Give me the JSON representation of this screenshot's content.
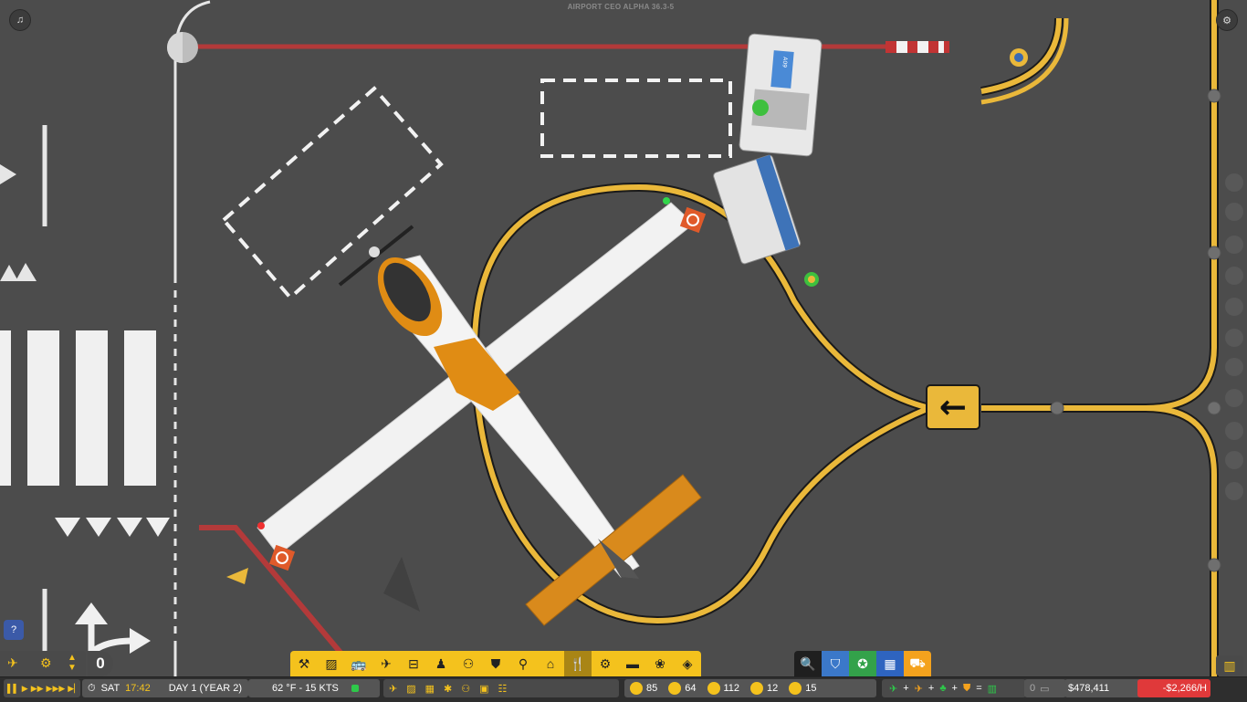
{
  "window": {
    "title": "AIRPORT CEO ALPHA 36.3-5"
  },
  "top_left_button": {
    "icon": "alert-icon",
    "glyph": "♫"
  },
  "top_right_button": {
    "icon": "settings-icon",
    "glyph": "⚙"
  },
  "scene": {
    "aircraft_stand_sign": "←",
    "service_vehicle_label": "A09"
  },
  "help_button": {
    "label": "?"
  },
  "left_panel": {
    "counter": "0"
  },
  "toolbar": {
    "items": [
      {
        "name": "build-icon",
        "glyph": "⚒"
      },
      {
        "name": "zone-icon",
        "glyph": "▨"
      },
      {
        "name": "vehicle-icon",
        "glyph": "🚌"
      },
      {
        "name": "runway-icon",
        "glyph": "✈"
      },
      {
        "name": "baggage-icon",
        "glyph": "⊟"
      },
      {
        "name": "staff-icon",
        "glyph": "♟"
      },
      {
        "name": "passengers-icon",
        "glyph": "⚇"
      },
      {
        "name": "security-icon",
        "glyph": "⛊"
      },
      {
        "name": "restroom-icon",
        "glyph": "⚲"
      },
      {
        "name": "furniture-icon",
        "glyph": "⌂"
      },
      {
        "name": "food-icon",
        "glyph": "🍴"
      },
      {
        "name": "shop-icon",
        "glyph": "⚙"
      },
      {
        "name": "seating-icon",
        "glyph": "▬"
      },
      {
        "name": "decor-icon",
        "glyph": "❀"
      },
      {
        "name": "layers-icon",
        "glyph": "◈"
      }
    ],
    "right_items": [
      {
        "name": "search-icon",
        "glyph": "🔍",
        "color": "#1f1f1f"
      },
      {
        "name": "shield-icon",
        "glyph": "⛉",
        "color": "#3b78c9"
      },
      {
        "name": "globe-icon",
        "glyph": "✪",
        "color": "#33a24a"
      },
      {
        "name": "grid-icon",
        "glyph": "▦",
        "color": "#2e64c0"
      },
      {
        "name": "fuel-truck-icon",
        "glyph": "⛟",
        "color": "#f4a21d"
      }
    ]
  },
  "bottom_bar": {
    "speed_controls": [
      "▌▌",
      "▶",
      "▶▶",
      "▶▶▶",
      "▶▏"
    ],
    "day": "SAT",
    "time": "17:42",
    "date": "DAY 1 (YEAR 2)",
    "weather": "62 °F - 15 KTS",
    "counts": [
      {
        "icon": "flight-icon",
        "value": "85"
      },
      {
        "icon": "person-icon",
        "value": "64"
      },
      {
        "icon": "bag-icon",
        "value": "112"
      },
      {
        "icon": "plane-icon",
        "value": "12"
      },
      {
        "icon": "seat-icon",
        "value": "15"
      }
    ],
    "rating_formula": [
      "+",
      "+",
      "+",
      "="
    ],
    "balance": "$478,411",
    "rate": "-$2,266/H",
    "rate_value": "0"
  },
  "colors": {
    "taxi_line": "#eab83a",
    "tarmac": "#4b4b4b",
    "hold_line": "#c03030",
    "accent": "#f4c21d",
    "negative": "#e0393a",
    "aircraft_livery": "#e08c14"
  }
}
